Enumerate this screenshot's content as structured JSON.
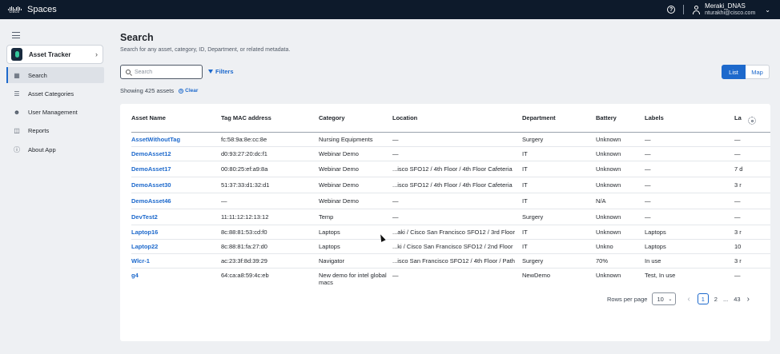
{
  "topbar": {
    "logo_text": "cisco",
    "app_title": "Spaces",
    "help_icon": "question-circle-icon",
    "user_name": "Meraki_DNAS",
    "user_email": "nturakhi@cisco.com"
  },
  "sidebar": {
    "app_switch_label": "Asset Tracker",
    "items": [
      {
        "label": "Search",
        "icon": "grid-icon",
        "active": true
      },
      {
        "label": "Asset Categories",
        "icon": "layers-icon",
        "active": false
      },
      {
        "label": "User Management",
        "icon": "user-icon",
        "active": false
      },
      {
        "label": "Reports",
        "icon": "report-icon",
        "active": false
      },
      {
        "label": "About App",
        "icon": "info-icon",
        "active": false
      }
    ]
  },
  "main": {
    "title": "Search",
    "subtitle": "Search for any asset, category, ID, Department, or related metadata.",
    "search_placeholder": "Search",
    "search_value": "",
    "filters_label": "Filters",
    "showing_text": "Showing 425 assets",
    "clear_label": "Clear",
    "view_list": "List",
    "view_map": "Map"
  },
  "table": {
    "columns": [
      "Asset Name",
      "Tag MAC address",
      "Category",
      "Location",
      "Department",
      "Battery",
      "Labels",
      "La"
    ],
    "rows": [
      [
        "AssetWithoutTag",
        "fc:58:9a:8e:cc:8e",
        "Nursing Equipments",
        "—",
        "Surgery",
        "Unknown",
        "—",
        "—"
      ],
      [
        "DemoAsset12",
        "d0:93:27:20:dc:f1",
        "Webinar Demo",
        "—",
        "IT",
        "Unknown",
        "—",
        "—"
      ],
      [
        "DemoAsset17",
        "00:80:25:ef:a9:8a",
        "Webinar Demo",
        "...isco SFO12 / 4th Floor / 4th Floor Cafeteria",
        "IT",
        "Unknown",
        "—",
        "7 d"
      ],
      [
        "DemoAsset30",
        "51:37:33:d1:32:d1",
        "Webinar Demo",
        "...isco SFO12 / 4th Floor / 4th Floor Cafeteria",
        "IT",
        "Unknown",
        "—",
        "3 r"
      ],
      [
        "DemoAsset46",
        "—",
        "Webinar Demo",
        "—",
        "IT",
        "N/A",
        "—",
        "—"
      ],
      [
        "DevTest2",
        "11:11:12:12:13:12",
        "Temp",
        "—",
        "Surgery",
        "Unknown",
        "—",
        "—"
      ],
      [
        "Laptop16",
        "8c:88:81:53:cd:f0",
        "Laptops",
        "...aki / Cisco San Francisco SFO12 / 3rd Floor",
        "IT",
        "Unknown",
        "Laptops",
        "3 r"
      ],
      [
        "Laptop22",
        "8c:88:81:fa:27:d0",
        "Laptops",
        "...ki / Cisco San Francisco SFO12 / 2nd Floor",
        "IT",
        "Unkno",
        "Laptops",
        "10"
      ],
      [
        "Wlcr-1",
        "ac:23:3f:8d:39:29",
        "Navigator",
        "...isco San Francisco SFO12 / 4th Floor / Path",
        "Surgery",
        "70%",
        "In use",
        "3 r"
      ],
      [
        "g4",
        "64:ca:a8:59:4c:eb",
        "New demo for intel global macs",
        "—",
        "NewDemo",
        "Unknown",
        "Test, In use",
        "—"
      ]
    ]
  },
  "pagination": {
    "rows_per_page_label": "Rows per page",
    "rows_per_page_value": "10",
    "pages": [
      "1",
      "2",
      "...",
      "43"
    ],
    "current": "1"
  }
}
